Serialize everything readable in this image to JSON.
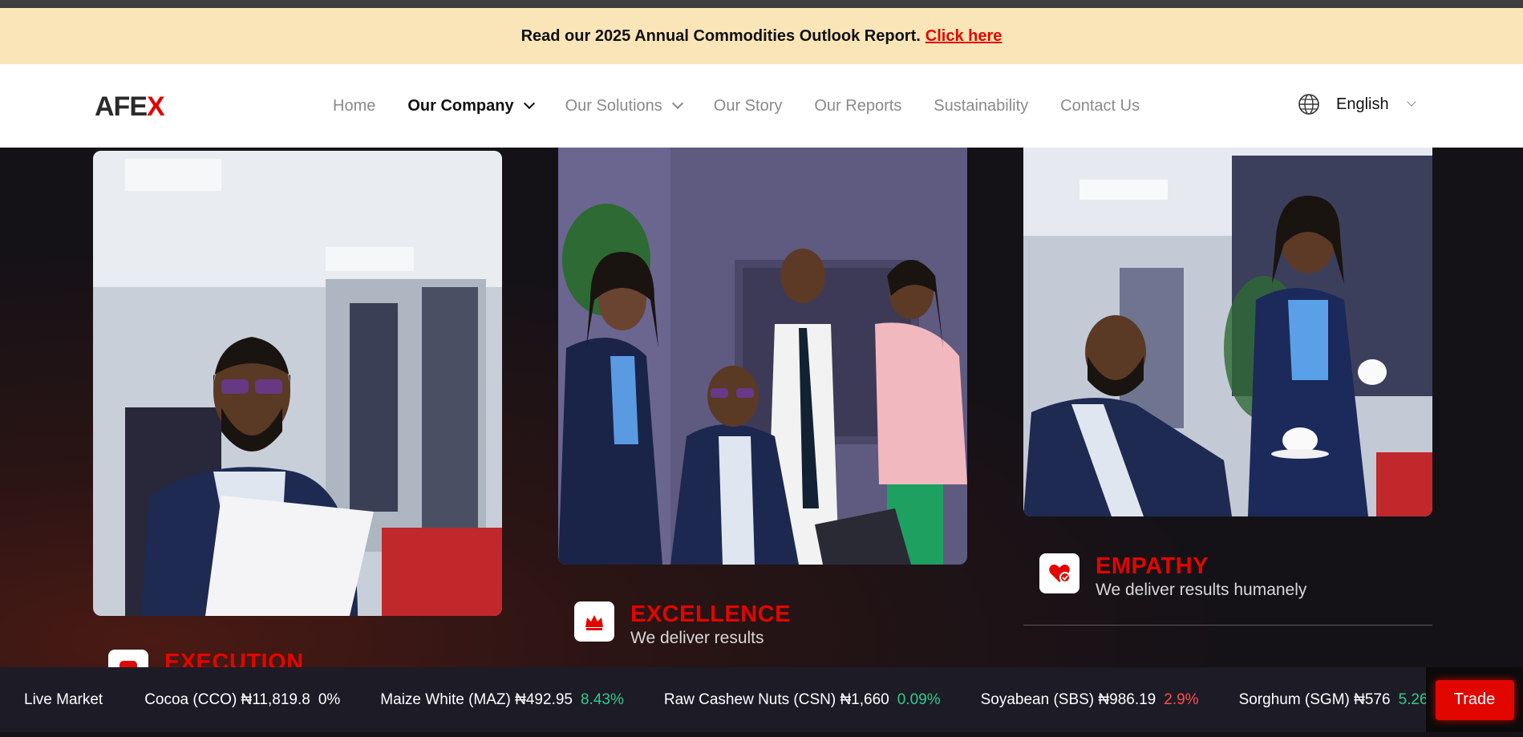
{
  "banner": {
    "text": "Read our 2025 Annual Commodities Outlook Report.",
    "link": "Click here"
  },
  "nav": {
    "logo_prefix": "AFE",
    "logo_accent": "X",
    "items": [
      {
        "label": "Home"
      },
      {
        "label": "Our Company",
        "active": true,
        "dropdown": true
      },
      {
        "label": "Our Solutions",
        "dropdown": true
      },
      {
        "label": "Our Story"
      },
      {
        "label": "Our Reports"
      },
      {
        "label": "Sustainability"
      },
      {
        "label": "Contact Us"
      }
    ],
    "language": "English"
  },
  "values": [
    {
      "title": "EXECUTION",
      "subtitle": "",
      "icon": "execution-icon"
    },
    {
      "title": "EXCELLENCE",
      "subtitle": "We deliver results",
      "icon": "crown-icon"
    },
    {
      "title": "EMPATHY",
      "subtitle": "We deliver results humanely",
      "icon": "heart-check-icon"
    }
  ],
  "ticker": {
    "label": "Live Market",
    "items": [
      {
        "name": "Cocoa (CCO) ₦11,819.8",
        "change": "0%",
        "trend": "flat"
      },
      {
        "name": "Maize White (MAZ) ₦492.95",
        "change": "8.43%",
        "trend": "up"
      },
      {
        "name": "Raw Cashew Nuts (CSN) ₦1,660",
        "change": "0.09%",
        "trend": "up"
      },
      {
        "name": "Soyabean (SBS) ₦986.19",
        "change": "2.9%",
        "trend": "down"
      },
      {
        "name": "Sorghum (SGM) ₦576",
        "change": "5.26",
        "trend": "up"
      }
    ],
    "cta": "Trade"
  },
  "colors": {
    "brand_red": "#e10600",
    "banner_bg": "#fae5b8",
    "up": "#2ecc8a",
    "down": "#ff4d4d"
  }
}
